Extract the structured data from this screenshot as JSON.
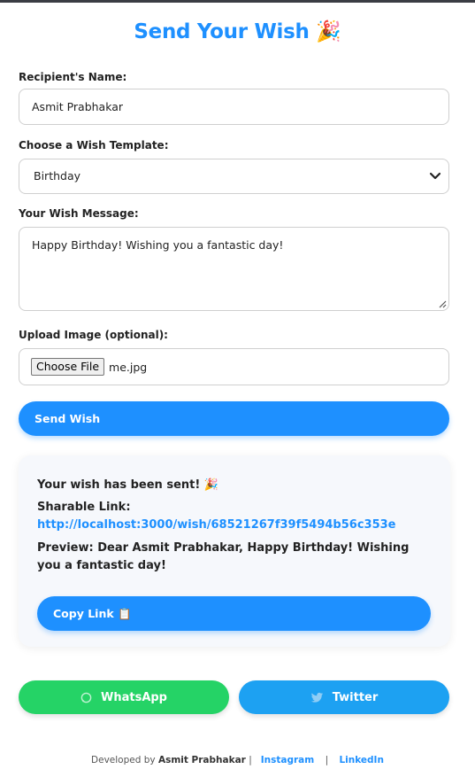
{
  "header": {
    "title": "Send Your Wish 🎉"
  },
  "form": {
    "recipient_label": "Recipient's Name:",
    "recipient_value": "Asmit Prabhakar",
    "template_label": "Choose a Wish Template:",
    "template_value": "Birthday",
    "message_label": "Your Wish Message:",
    "message_value": "Happy Birthday! Wishing you a fantastic day!",
    "upload_label": "Upload Image (optional):",
    "choose_file_label": "Choose File",
    "file_name": "me.jpg",
    "send_button": "Send Wish"
  },
  "result": {
    "sent_text": "Your wish has been sent! 🎉",
    "sharable_label": "Sharable Link:",
    "link": "http://localhost:3000/wish/68521267f39f5494b56c353e",
    "preview": "Preview: Dear Asmit Prabhakar, Happy Birthday! Wishing you a fantastic day!",
    "copy_button": "Copy Link 📋"
  },
  "share": {
    "whatsapp": "WhatsApp",
    "twitter": "Twitter"
  },
  "footer": {
    "developed_by": "Developed by",
    "author": "Asmit Prabhakar",
    "separator": "|",
    "instagram": "Instagram",
    "linkedin": "LinkedIn"
  },
  "colors": {
    "accent": "#1e90ff",
    "whatsapp": "#25d366",
    "twitter": "#1da1f2"
  }
}
